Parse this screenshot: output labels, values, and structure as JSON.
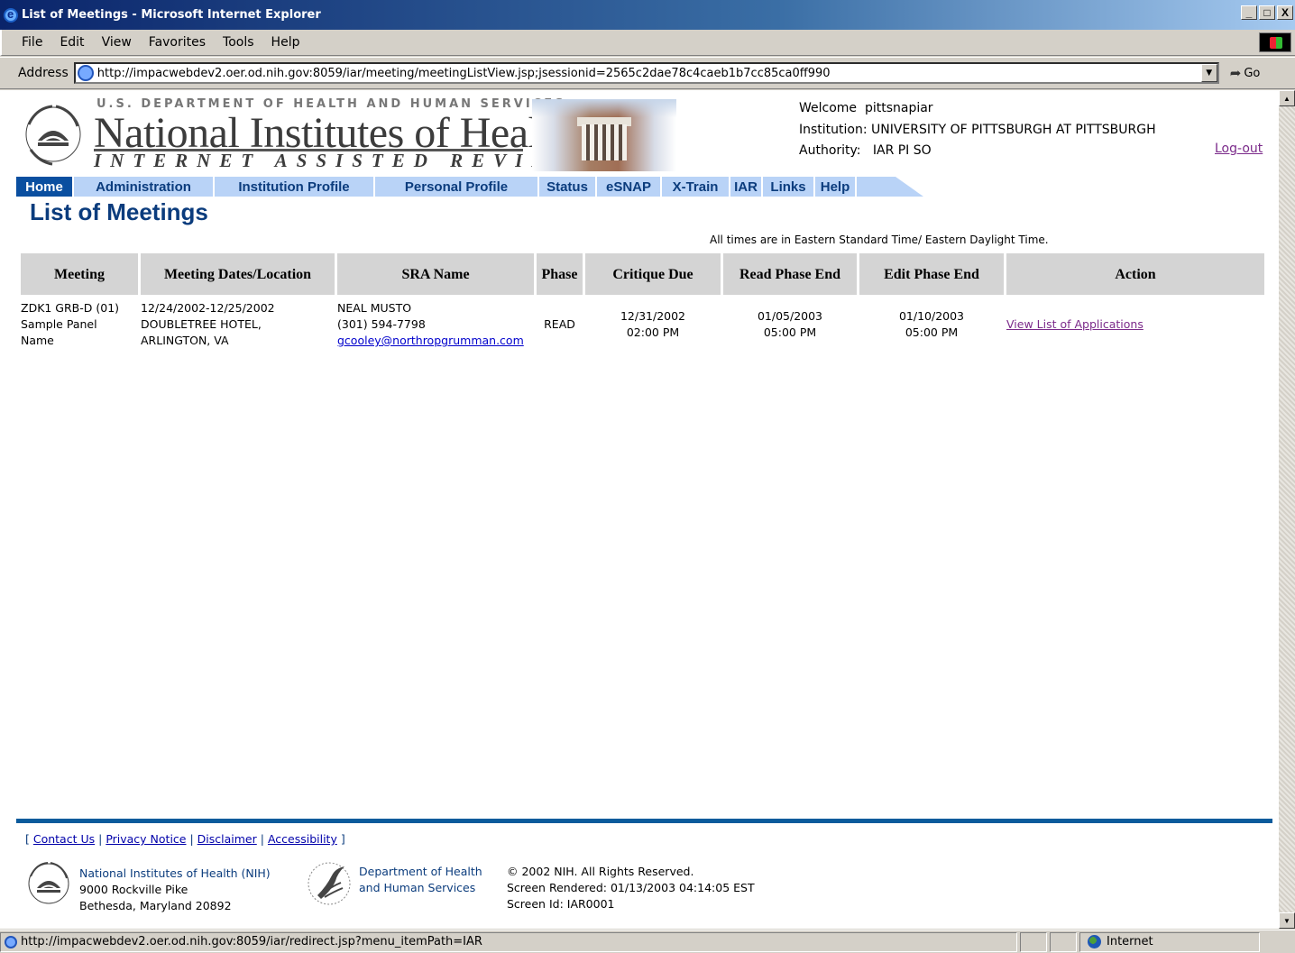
{
  "window": {
    "title": "List of Meetings - Microsoft Internet Explorer",
    "minimize": "_",
    "maximize": "□",
    "close": "X"
  },
  "menu": [
    "File",
    "Edit",
    "View",
    "Favorites",
    "Tools",
    "Help"
  ],
  "address": {
    "label": "Address",
    "url": "http://impacwebdev2.oer.od.nih.gov:8059/iar/meeting/meetingListView.jsp;jsessionid=2565c2dae78c4caeb1b7cc85ca0ff990",
    "go": "Go"
  },
  "header": {
    "dept": "U.S. DEPARTMENT OF HEALTH AND HUMAN SERVICES",
    "org": "National Institutes of Health",
    "system": "INTERNET ASSISTED REVIEW",
    "welcome_label": "Welcome",
    "user": "pittsnapiar",
    "institution_label": "Institution:",
    "institution": "UNIVERSITY OF PITTSBURGH AT PITTSBURGH",
    "authority_label": "Authority:",
    "authority": "IAR PI SO",
    "logout": "Log-out"
  },
  "nav": [
    "Home",
    "Administration",
    "Institution Profile",
    "Personal Profile",
    "Status",
    "eSNAP",
    "X-Train",
    "IAR",
    "Links",
    "Help"
  ],
  "page": {
    "title": "List of Meetings",
    "times_note": "All times are in Eastern Standard Time/ Eastern Daylight Time."
  },
  "table": {
    "headers": [
      "Meeting",
      "Meeting Dates/Location",
      "SRA Name",
      "Phase",
      "Critique Due",
      "Read Phase End",
      "Edit Phase End",
      "Action"
    ],
    "rows": [
      {
        "meeting": [
          "ZDK1 GRB-D (01)",
          "Sample Panel",
          "Name"
        ],
        "dates_location": [
          "12/24/2002-12/25/2002",
          "DOUBLETREE HOTEL,",
          "ARLINGTON, VA"
        ],
        "sra_name": "NEAL MUSTO",
        "sra_phone": "(301) 594-7798",
        "sra_email": "gcooley@northropgrumman.com",
        "phase": "READ",
        "critique_due": [
          "12/31/2002",
          "02:00 PM"
        ],
        "read_phase_end": [
          "01/05/2003",
          "05:00 PM"
        ],
        "edit_phase_end": [
          "01/10/2003",
          "05:00 PM"
        ],
        "action": "View List of Applications"
      }
    ]
  },
  "footer": {
    "links": [
      "Contact Us",
      "Privacy Notice",
      "Disclaimer",
      "Accessibility"
    ],
    "nih": [
      "National Institutes of Health (NIH)",
      "9000 Rockville Pike",
      "Bethesda, Maryland 20892"
    ],
    "hhs": [
      "Department of Health",
      "and Human Services"
    ],
    "copyright": "© 2002 NIH. All Rights Reserved.",
    "rendered": "Screen Rendered: 01/13/2003 04:14:05 EST",
    "screen_id": "Screen Id: IAR0001"
  },
  "status": {
    "url": "http://impacwebdev2.oer.od.nih.gov:8059/iar/redirect.jsp?menu_itemPath=IAR",
    "zone": "Internet"
  }
}
